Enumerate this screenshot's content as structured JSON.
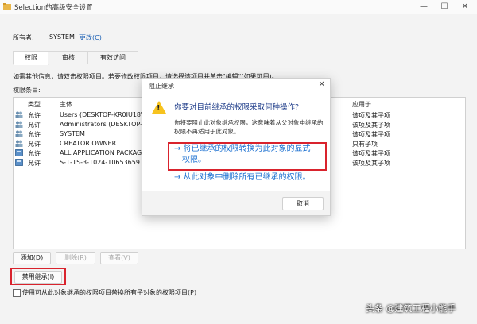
{
  "window": {
    "title": "Selection的高级安全设置",
    "min": "—",
    "max": "☐",
    "close": "✕"
  },
  "owner": {
    "label": "所有者:",
    "value": "SYSTEM",
    "change_link": "更改(C)"
  },
  "tabs": [
    "权限",
    "审核",
    "有效访问"
  ],
  "hint_text": "如需其他信息，请双击权限项目。若要修改权限项目，请选择该项目并单击\"编辑\"(如果可用)。",
  "entries_label": "权限条目:",
  "columns": {
    "type": "类型",
    "principal": "主体",
    "applies": "应用于"
  },
  "rows": [
    {
      "type": "允许",
      "principal": "Users (DESKTOP-KR0IU18\\",
      "applies": "该项及其子项",
      "icon": "users-icon"
    },
    {
      "type": "允许",
      "principal": "Administrators (DESKTOP-K",
      "applies": "该项及其子项",
      "icon": "users-icon"
    },
    {
      "type": "允许",
      "principal": "SYSTEM",
      "applies": "该项及其子项",
      "icon": "users-icon"
    },
    {
      "type": "允许",
      "principal": "CREATOR OWNER",
      "applies": "只有子项",
      "icon": "users-icon"
    },
    {
      "type": "允许",
      "principal": "ALL APPLICATION PACKAG",
      "applies": "该项及其子项",
      "icon": "package-icon"
    },
    {
      "type": "允许",
      "principal": "S-1-15-3-1024-10653659",
      "applies": "该项及其子项",
      "icon": "package-icon"
    }
  ],
  "buttons": {
    "add": "添加(D)",
    "remove": "删除(R)",
    "view": "查看(V)",
    "disable_inheritance": "禁用继承(I)"
  },
  "replace_checkbox": {
    "label": "使用可从此对象继承的权限项目替换所有子对象的权限项目(P)",
    "checked": false
  },
  "dialog": {
    "title": "阻止继承",
    "close": "✕",
    "question": "你要对目前继承的权限采取何种操作?",
    "description": "你将要阻止此对象继承权限，这意味着从父对象中继承的权限不再适用于此对象。",
    "option1_line1": "→ 将已继承的权限转换为此对象的显式",
    "option1_line2": "权限。",
    "option2": "→ 从此对象中删除所有已继承的权限。",
    "cancel": "取消"
  },
  "watermark": "头条 @建筑工程小能手",
  "colors": {
    "link": "#1a5fb4",
    "highlight": "#d9232d",
    "dialog_option": "#1a6fd0"
  }
}
